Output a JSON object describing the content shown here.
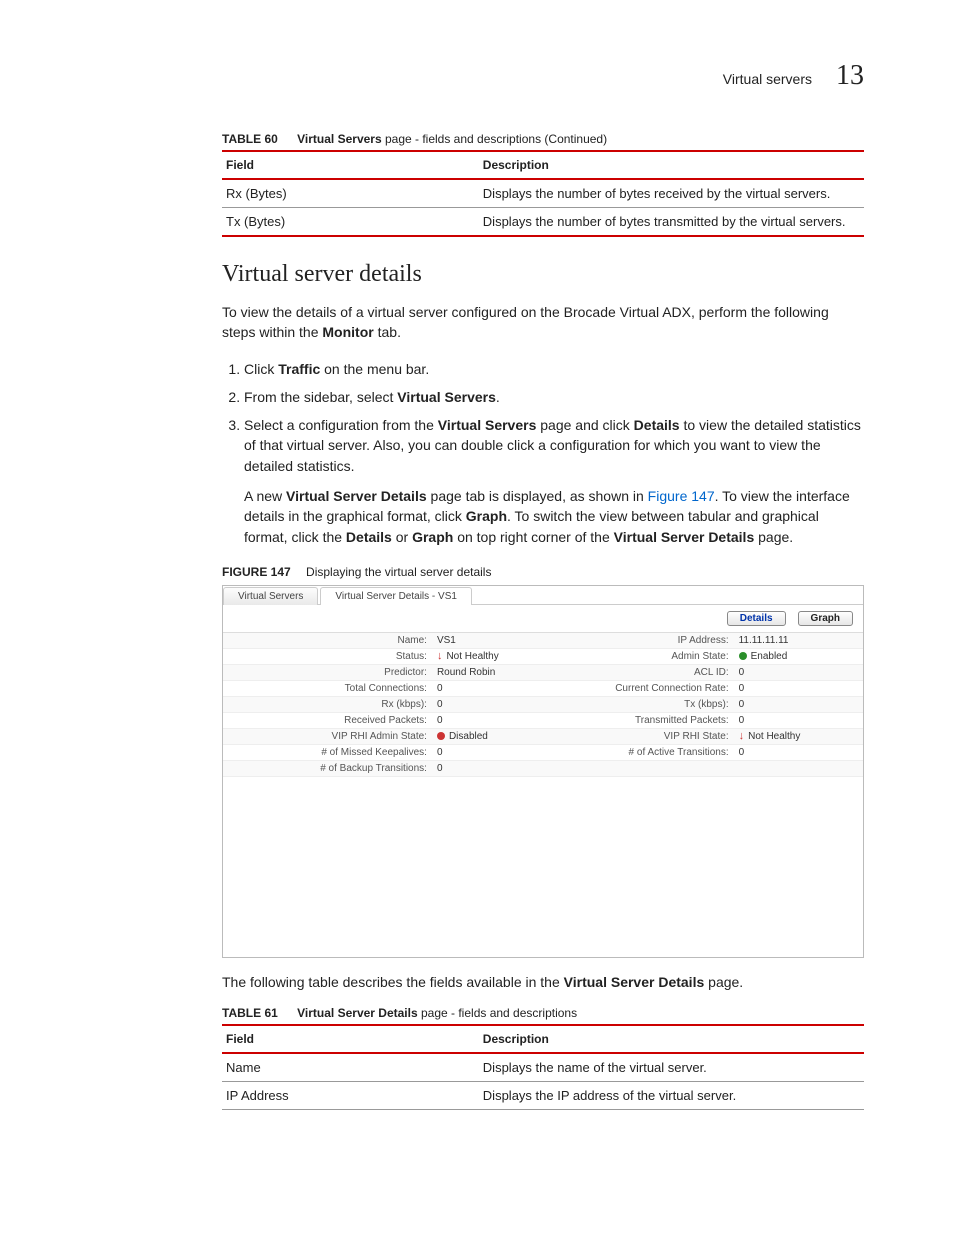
{
  "header": {
    "section": "Virtual servers",
    "page_num": "13"
  },
  "table60": {
    "label": "TABLE 60",
    "title_bold": "Virtual Servers",
    "title_rest": " page - fields and descriptions (Continued)",
    "col_field": "Field",
    "col_desc": "Description",
    "rows": [
      {
        "field": "Rx (Bytes)",
        "desc": "Displays the number of bytes received by the virtual servers."
      },
      {
        "field": "Tx (Bytes)",
        "desc": "Displays the number of bytes transmitted by the virtual servers."
      }
    ]
  },
  "section_title": "Virtual server details",
  "intro_1": "To view the details of a virtual server configured on the Brocade Virtual ADX, perform the following steps within the ",
  "intro_monitor": "Monitor",
  "intro_2": " tab.",
  "steps": {
    "s1_a": "Click ",
    "s1_b": "Traffic",
    "s1_c": " on the menu bar.",
    "s2_a": "From the sidebar, select ",
    "s2_b": "Virtual Servers",
    "s2_c": ".",
    "s3_a": "Select a configuration from the ",
    "s3_b": "Virtual Servers",
    "s3_c": " page and click ",
    "s3_d": "Details",
    "s3_e": " to view the detailed statistics of that virtual server. Also, you can double click a configuration for which you want to view the detailed statistics.",
    "s3p2_a": "A new ",
    "s3p2_b": "Virtual Server Details",
    "s3p2_c": " page tab is displayed, as shown in ",
    "s3p2_link": "Figure 147",
    "s3p2_d": ". To view the interface details in the graphical format, click ",
    "s3p2_e": "Graph",
    "s3p2_f": ". To switch the view between tabular and graphical format, click the ",
    "s3p2_g": "Details",
    "s3p2_h": " or ",
    "s3p2_i": "Graph",
    "s3p2_j": " on top right corner of the ",
    "s3p2_k": "Virtual Server Details",
    "s3p2_l": " page."
  },
  "figure": {
    "label": "FIGURE 147",
    "caption": "Displaying the virtual server details",
    "tab1": "Virtual Servers",
    "tab2": "Virtual Server Details - VS1",
    "btn_details": "Details",
    "btn_graph": "Graph",
    "rows": [
      {
        "l1": "Name:",
        "v1": "VS1",
        "l2": "IP Address:",
        "v2": "11.11.11.11"
      },
      {
        "l1": "Status:",
        "v1": "Not Healthy",
        "v1_icon": "down",
        "l2": "Admin State:",
        "v2": "Enabled",
        "v2_icon": "green"
      },
      {
        "l1": "Predictor:",
        "v1": "Round Robin",
        "l2": "ACL ID:",
        "v2": "0"
      },
      {
        "l1": "Total Connections:",
        "v1": "0",
        "l2": "Current Connection Rate:",
        "v2": "0"
      },
      {
        "l1": "Rx (kbps):",
        "v1": "0",
        "l2": "Tx (kbps):",
        "v2": "0"
      },
      {
        "l1": "Received Packets:",
        "v1": "0",
        "l2": "Transmitted Packets:",
        "v2": "0"
      },
      {
        "l1": "VIP RHI Admin State:",
        "v1": "Disabled",
        "v1_icon": "red",
        "l2": "VIP RHI State:",
        "v2": "Not Healthy",
        "v2_icon": "down"
      },
      {
        "l1": "# of Missed Keepalives:",
        "v1": "0",
        "l2": "# of Active Transitions:",
        "v2": "0"
      },
      {
        "l1": "# of Backup Transitions:",
        "v1": "0",
        "l2": "",
        "v2": ""
      }
    ]
  },
  "post_fig_a": "The following table describes the fields available in the ",
  "post_fig_b": "Virtual Server Details",
  "post_fig_c": " page.",
  "table61": {
    "label": "TABLE 61",
    "title_bold": "Virtual Server Details",
    "title_rest": " page - fields and descriptions",
    "col_field": "Field",
    "col_desc": "Description",
    "rows": [
      {
        "field": "Name",
        "desc": "Displays the name of the virtual server."
      },
      {
        "field": "IP Address",
        "desc": "Displays the IP address of the virtual server."
      }
    ]
  }
}
